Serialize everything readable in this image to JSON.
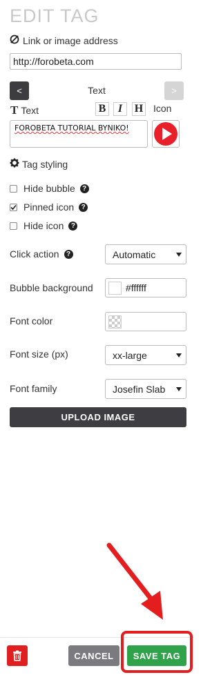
{
  "title": "EDIT TAG",
  "link": {
    "label": "Link or image address",
    "value": "http://forobeta.com",
    "icon": "link-icon"
  },
  "text_nav": {
    "prev": "<",
    "label": "Text",
    "next": ">"
  },
  "text_section": {
    "label": "Text",
    "bold": "B",
    "italic": "I",
    "heading": "H",
    "icon_label": "Icon",
    "value": "FOROBETA TUTORIAL BYNIKO!"
  },
  "styling": {
    "label": "Tag styling",
    "icon": "gear-icon"
  },
  "options": [
    {
      "label": "Hide bubble",
      "checked": false
    },
    {
      "label": "Pinned icon",
      "checked": true
    },
    {
      "label": "Hide icon",
      "checked": false
    }
  ],
  "click_action": {
    "label": "Click action",
    "value": "Automatic"
  },
  "bubble_background": {
    "label": "Bubble background",
    "value": "#ffffff"
  },
  "font_color": {
    "label": "Font color",
    "value": ""
  },
  "font_size": {
    "label": "Font size (px)",
    "value": "xx-large"
  },
  "font_family": {
    "label": "Font family",
    "value": "Josefin Slab"
  },
  "buttons": {
    "upload": "UPLOAD IMAGE",
    "cancel": "CANCEL",
    "save": "SAVE TAG"
  },
  "colors": {
    "save": "#2fa24a",
    "delete": "#e02020",
    "highlight": "#e41e1e",
    "upload": "#3d3d42"
  }
}
